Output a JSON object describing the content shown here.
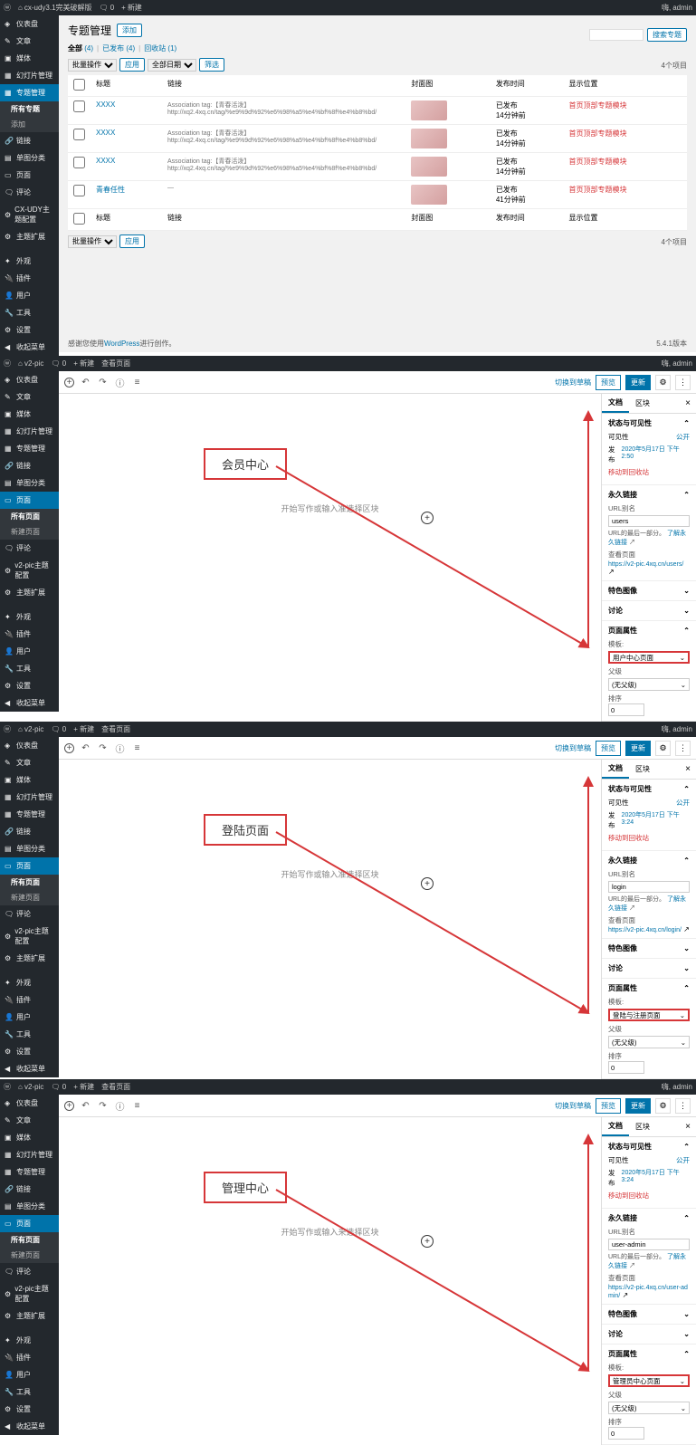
{
  "panel1": {
    "adminbar": {
      "site": "cx-udy3.1完美破解版",
      "comments": "0",
      "new": "新建",
      "user": "admin",
      "greet": "嗨,"
    },
    "side": {
      "items": [
        "仪表盘",
        "文章",
        "媒体",
        "幻灯片管理",
        "专题管理",
        "链接",
        "单图分类",
        "页面",
        "评论",
        "CX-UDY主题配置",
        "主题扩展",
        "外观",
        "插件",
        "用户",
        "工具",
        "设置",
        "收起菜单"
      ],
      "sub": [
        "所有专题",
        "添加"
      ]
    },
    "page_title": "专题管理",
    "add_btn": "添加",
    "filter": {
      "all": "全部",
      "all_n": "(4)",
      "pub": "已发布",
      "pub_n": "(4)",
      "trash": "回收站",
      "trash_n": "(1)"
    },
    "bulk_sel": "批量操作",
    "apply": "应用",
    "date_sel": "全部日期",
    "filter_btn": "筛选",
    "search_btn": "搜索专题",
    "count": "4个项目",
    "cols": {
      "title": "标题",
      "slug": "链接",
      "cover": "封面图",
      "date": "发布时间",
      "pos": "显示位置"
    },
    "rows": [
      {
        "title": "XXXX",
        "slug_t": "Association tag:【青春活泼】",
        "slug_u": "http://xq2.4xq.cn/tag/%e9%9d%92%e6%98%a5%e4%bf%8f%e4%b8%bd/",
        "date1": "已发布",
        "date2": "14分钟前",
        "pos": "首页顶部专题模块"
      },
      {
        "title": "XXXX",
        "slug_t": "Association tag:【青春活泼】",
        "slug_u": "http://xq2.4xq.cn/tag/%e9%9d%92%e6%98%a5%e4%bf%8f%e4%b8%bd/",
        "date1": "已发布",
        "date2": "14分钟前",
        "pos": "首页顶部专题模块"
      },
      {
        "title": "XXXX",
        "slug_t": "Association tag:【青春活泼】",
        "slug_u": "http://xq2.4xq.cn/tag/%e9%9d%92%e6%98%a5%e4%bf%8f%e4%b8%bd/",
        "date1": "已发布",
        "date2": "14分钟前",
        "pos": "首页顶部专题模块"
      },
      {
        "title": "青春任性",
        "slug_t": "—",
        "slug_u": "",
        "date1": "已发布",
        "date2": "41分钟前",
        "pos": "首页顶部专题模块"
      }
    ],
    "footer_l": "感谢您使用",
    "footer_wp": "WordPress",
    "footer_l2": "进行创作。",
    "ver": "5.4.1版本"
  },
  "editors": [
    {
      "adminbar": {
        "site": "v2-pic",
        "comments": "0",
        "new": "新建",
        "view": "查看页面",
        "user": "admin"
      },
      "side": {
        "items": [
          "仪表盘",
          "文章",
          "媒体",
          "幻灯片管理",
          "专题管理",
          "链接",
          "单图分类",
          "页面",
          "评论",
          "v2-pic主题配置",
          "主题扩展",
          "外观",
          "插件",
          "用户",
          "工具",
          "设置",
          "收起菜单"
        ],
        "sub": [
          "所有页面",
          "新建页面"
        ],
        "active_idx": 7
      },
      "title_text": "会员中心",
      "placeholder": "开始写作或输入准选择区块",
      "top": {
        "switch": "切换到草稿",
        "preview": "预览",
        "update": "更新"
      },
      "inspector": {
        "tabs": [
          "文档",
          "区块"
        ],
        "status_h": "状态与可见性",
        "vis_k": "可见性",
        "vis_v": "公开",
        "pub_k": "发布",
        "pub_v": "2020年5月17日 下午2:50",
        "trash": "移动到回收站",
        "perma_h": "永久链接",
        "slug_k": "URL别名",
        "slug_v": "users",
        "slug_hint": "URL的最后一部分。",
        "learn": "了解永久链接",
        "view_k": "查看页面",
        "view_u": "https://v2-pic.4xq.cn/users/",
        "img_h": "特色图像",
        "disc_h": "讨论",
        "attr_h": "页面属性",
        "tpl_k": "模板:",
        "tpl_v": "用户中心页面",
        "parent_k": "父级",
        "parent_v": "(无父级)",
        "order_k": "排序",
        "order_v": "0"
      }
    },
    {
      "adminbar": {
        "site": "v2-pic",
        "comments": "0",
        "new": "新建",
        "view": "查看页面",
        "user": "admin"
      },
      "side": {
        "items": [
          "仪表盘",
          "文章",
          "媒体",
          "幻灯片管理",
          "专题管理",
          "链接",
          "单图分类",
          "页面",
          "评论",
          "v2-pic主题配置",
          "主题扩展",
          "外观",
          "插件",
          "用户",
          "工具",
          "设置",
          "收起菜单"
        ],
        "sub": [
          "所有页面",
          "新建页面"
        ],
        "active_idx": 7
      },
      "title_text": "登陆页面",
      "placeholder": "开始写作或输入准选择区块",
      "top": {
        "switch": "切换到草稿",
        "preview": "预览",
        "update": "更新"
      },
      "inspector": {
        "tabs": [
          "文档",
          "区块"
        ],
        "status_h": "状态与可见性",
        "vis_k": "可见性",
        "vis_v": "公开",
        "pub_k": "发布",
        "pub_v": "2020年5月17日 下午3:24",
        "trash": "移动到回收站",
        "perma_h": "永久链接",
        "slug_k": "URL别名",
        "slug_v": "login",
        "slug_hint": "URL的最后一部分。",
        "learn": "了解永久链接",
        "view_k": "查看页面",
        "view_u": "https://v2-pic.4xq.cn/login/",
        "img_h": "特色图像",
        "disc_h": "讨论",
        "attr_h": "页面属性",
        "tpl_k": "模板:",
        "tpl_v": "登陆与注册页面",
        "parent_k": "父级",
        "parent_v": "(无父级)",
        "order_k": "排序",
        "order_v": "0"
      }
    },
    {
      "adminbar": {
        "site": "v2-pic",
        "comments": "0",
        "new": "新建",
        "view": "查看页面",
        "user": "admin"
      },
      "side": {
        "items": [
          "仪表盘",
          "文章",
          "媒体",
          "幻灯片管理",
          "专题管理",
          "链接",
          "单图分类",
          "页面",
          "评论",
          "v2-pic主题配置",
          "主题扩展",
          "外观",
          "插件",
          "用户",
          "工具",
          "设置",
          "收起菜单"
        ],
        "sub": [
          "所有页面",
          "新建页面"
        ],
        "active_idx": 7
      },
      "title_text": "管理中心",
      "placeholder": "开始写作或输入来选择区块",
      "top": {
        "switch": "切换到草稿",
        "preview": "预览",
        "update": "更新"
      },
      "inspector": {
        "tabs": [
          "文档",
          "区块"
        ],
        "status_h": "状态与可见性",
        "vis_k": "可见性",
        "vis_v": "公开",
        "pub_k": "发布",
        "pub_v": "2020年5月17日 下午3:24",
        "trash": "移动到回收站",
        "perma_h": "永久链接",
        "slug_k": "URL别名",
        "slug_v": "user-admin",
        "slug_hint": "URL的最后一部分。",
        "learn": "了解永久链接",
        "view_k": "查看页面",
        "view_u": "https://v2-pic.4xq.cn/user-admin/",
        "img_h": "特色图像",
        "disc_h": "讨论",
        "attr_h": "页面属性",
        "tpl_k": "模板:",
        "tpl_v": "管理员中心页面",
        "parent_k": "父级",
        "parent_v": "(无父级)",
        "order_k": "排序",
        "order_v": "0"
      }
    }
  ]
}
